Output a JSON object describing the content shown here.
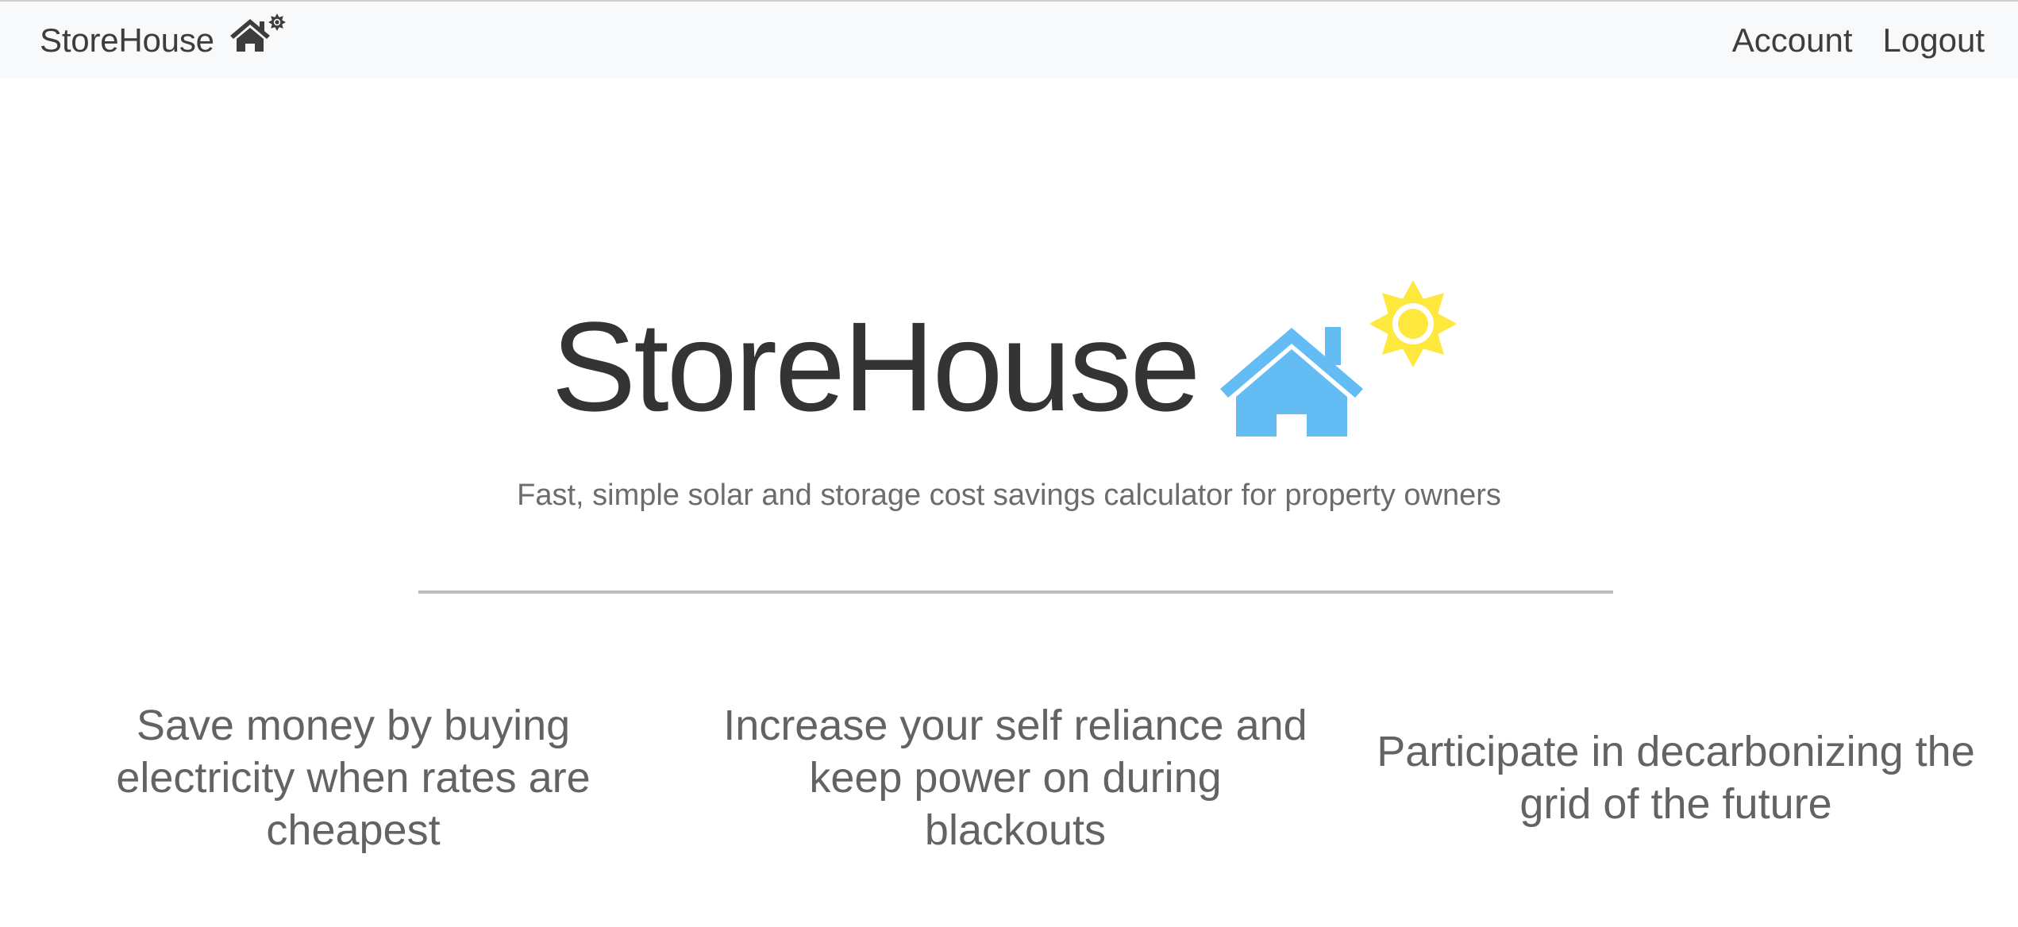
{
  "navbar": {
    "brand_label": "StoreHouse",
    "brand_icon": "house-sun-icon",
    "links": [
      {
        "label": "Account"
      },
      {
        "label": "Logout"
      }
    ]
  },
  "hero": {
    "title": "StoreHouse",
    "icon": "house-sun-icon",
    "subtitle": "Fast, simple solar and storage cost savings calculator for property owners"
  },
  "features": [
    {
      "text": "Save money by buying electricity when rates are cheapest"
    },
    {
      "text": "Increase your self reliance and keep power on during blackouts"
    },
    {
      "text": "Participate in decarbonizing the grid of the future"
    }
  ],
  "colors": {
    "navbar_bg": "#f8f9fa",
    "house_blue": "#64bcf5",
    "sun_yellow": "#ffe83d",
    "title_text": "#343434",
    "muted_text": "#6c6c6c",
    "nav_icon": "#3d3d3d"
  }
}
